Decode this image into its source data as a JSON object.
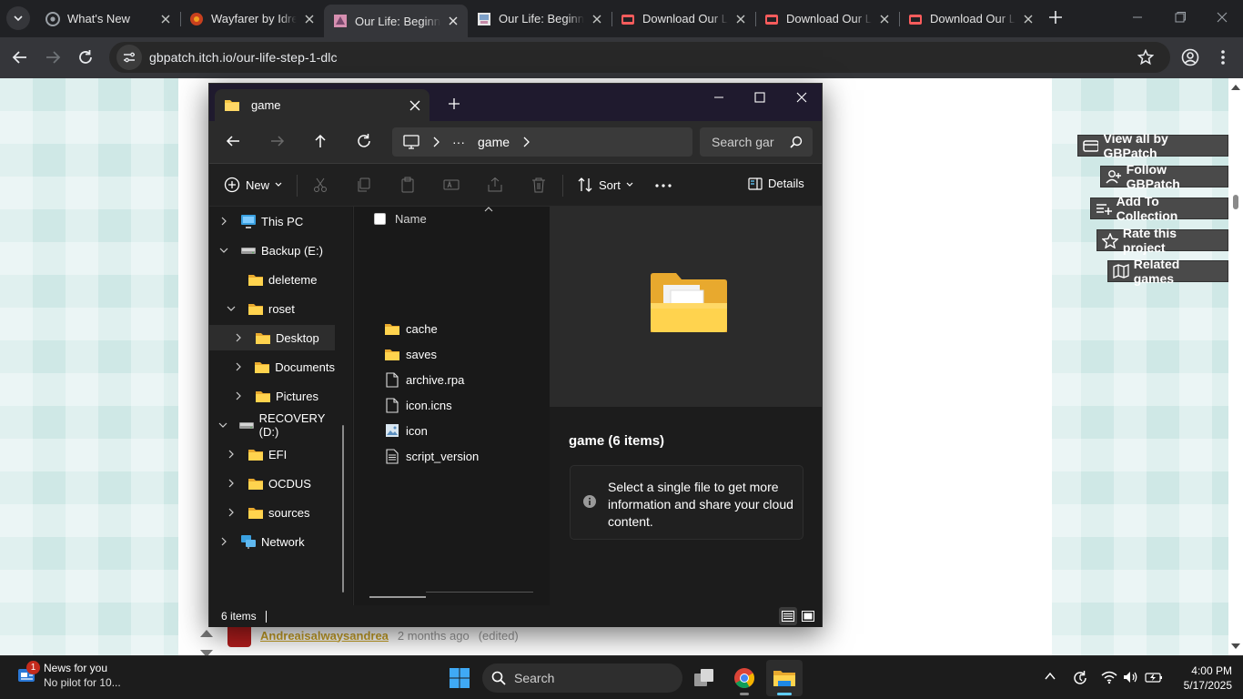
{
  "browser": {
    "tabs": [
      {
        "title": "What's New",
        "active": false
      },
      {
        "title": "Wayfarer by Idre",
        "active": false
      },
      {
        "title": "Our Life: Beginni",
        "active": true
      },
      {
        "title": "Our Life: Beginni",
        "active": false
      },
      {
        "title": "Download Our L",
        "active": false
      },
      {
        "title": "Download Our L",
        "active": false
      },
      {
        "title": "Download Our L",
        "active": false
      }
    ],
    "url": "gbpatch.itch.io/our-life-step-1-dlc"
  },
  "page": {
    "side_buttons": [
      {
        "label": "View all by GBPatch",
        "icon": "itch-icon"
      },
      {
        "label": "Follow GBPatch",
        "icon": "add-user-icon"
      },
      {
        "label": "Add To Collection",
        "icon": "add-list-icon"
      },
      {
        "label": "Rate this project",
        "icon": "star-icon"
      },
      {
        "label": "Related games",
        "icon": "map-icon"
      }
    ],
    "comment": {
      "author": "Andreaisalwaysandrea",
      "time": "2 months ago",
      "edited": "(edited)"
    }
  },
  "explorer": {
    "tab_title": "game",
    "breadcrumb": {
      "more": "···",
      "current": "game"
    },
    "search_placeholder": "Search gar",
    "commands": {
      "new": "New",
      "sort": "Sort",
      "details": "Details"
    },
    "nav": [
      {
        "label": "This PC",
        "icon": "computer-icon",
        "indent": 0,
        "chevron": "right"
      },
      {
        "label": "Backup (E:)",
        "icon": "drive-icon",
        "indent": 0,
        "chevron": "down"
      },
      {
        "label": "deleteme",
        "icon": "folder-icon",
        "indent": 1,
        "chevron": "none"
      },
      {
        "label": "roset",
        "icon": "folder-icon",
        "indent": 1,
        "chevron": "down"
      },
      {
        "label": "Desktop",
        "icon": "folder-icon",
        "indent": 2,
        "chevron": "right",
        "selected": true
      },
      {
        "label": "Documents",
        "icon": "folder-icon",
        "indent": 2,
        "chevron": "right"
      },
      {
        "label": "Pictures",
        "icon": "folder-icon",
        "indent": 2,
        "chevron": "right"
      },
      {
        "label": "RECOVERY (D:)",
        "icon": "drive-icon",
        "indent": 0,
        "chevron": "down"
      },
      {
        "label": "EFI",
        "icon": "folder-icon",
        "indent": 1,
        "chevron": "right"
      },
      {
        "label": "OCDUS",
        "icon": "folder-icon",
        "indent": 1,
        "chevron": "right"
      },
      {
        "label": "sources",
        "icon": "folder-icon",
        "indent": 1,
        "chevron": "right"
      },
      {
        "label": "Network",
        "icon": "network-icon",
        "indent": 0,
        "chevron": "right"
      }
    ],
    "column_header": "Name",
    "files": [
      {
        "name": "cache",
        "icon": "folder-icon"
      },
      {
        "name": "saves",
        "icon": "folder-icon"
      },
      {
        "name": "archive.rpa",
        "icon": "file-icon"
      },
      {
        "name": "icon.icns",
        "icon": "file-icon"
      },
      {
        "name": "icon",
        "icon": "image-file-icon"
      },
      {
        "name": "script_version",
        "icon": "text-file-icon"
      }
    ],
    "details": {
      "title": "game (6 items)",
      "info": "Select a single file to get more information and share your cloud content."
    },
    "status": "6 items"
  },
  "taskbar": {
    "news_title": "News for you",
    "news_sub": "No pilot for 10...",
    "news_badge": "1",
    "search_label": "Search",
    "time": "4:00 PM",
    "date": "5/17/2025"
  },
  "colors": {
    "page_bg": "#cfe8e6",
    "folder_yellow": "#f5c542",
    "accent_blue": "#60cdff",
    "link_gold": "#c9a227"
  }
}
